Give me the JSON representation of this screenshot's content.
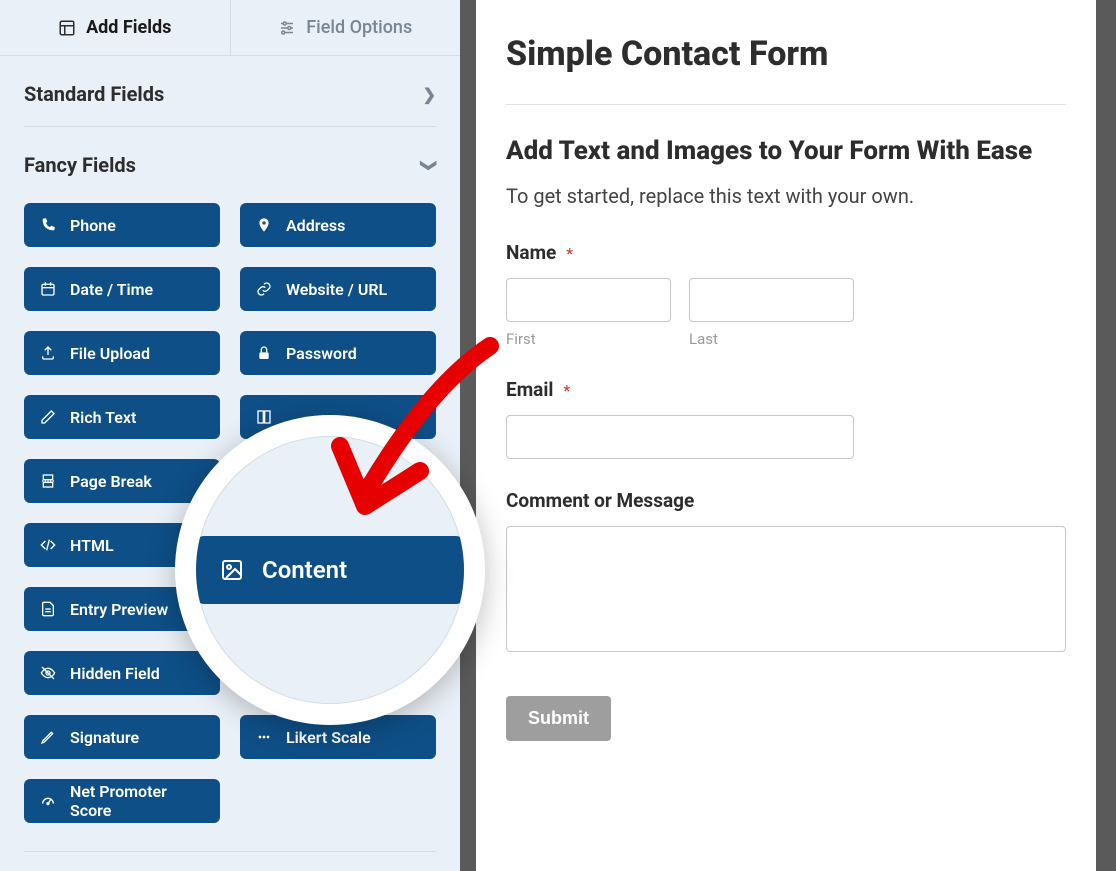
{
  "tabs": {
    "add_fields": "Add Fields",
    "field_options": "Field Options"
  },
  "sections": {
    "standard": {
      "title": "Standard Fields"
    },
    "fancy": {
      "title": "Fancy Fields",
      "fields": {
        "phone": "Phone",
        "address": "Address",
        "datetime": "Date / Time",
        "website": "Website / URL",
        "file_upload": "File Upload",
        "password": "Password",
        "rich_text": "Rich Text",
        "layout": "",
        "page_break": "Page Break",
        "html": "HTML",
        "content": "Content",
        "entry_preview": "Entry Preview",
        "hidden_field": "Hidden Field",
        "signature": "Signature",
        "likert": "Likert Scale",
        "nps": "Net Promoter Score"
      }
    }
  },
  "magnified_button": "Content",
  "form": {
    "title": "Simple Contact Form",
    "content_block": {
      "heading": "Add Text and Images to Your Form With Ease",
      "text": "To get started, replace this text with your own."
    },
    "name": {
      "label": "Name",
      "first_sub": "First",
      "last_sub": "Last"
    },
    "email": {
      "label": "Email"
    },
    "comment": {
      "label": "Comment or Message"
    },
    "submit": "Submit",
    "required_marker": "*"
  }
}
